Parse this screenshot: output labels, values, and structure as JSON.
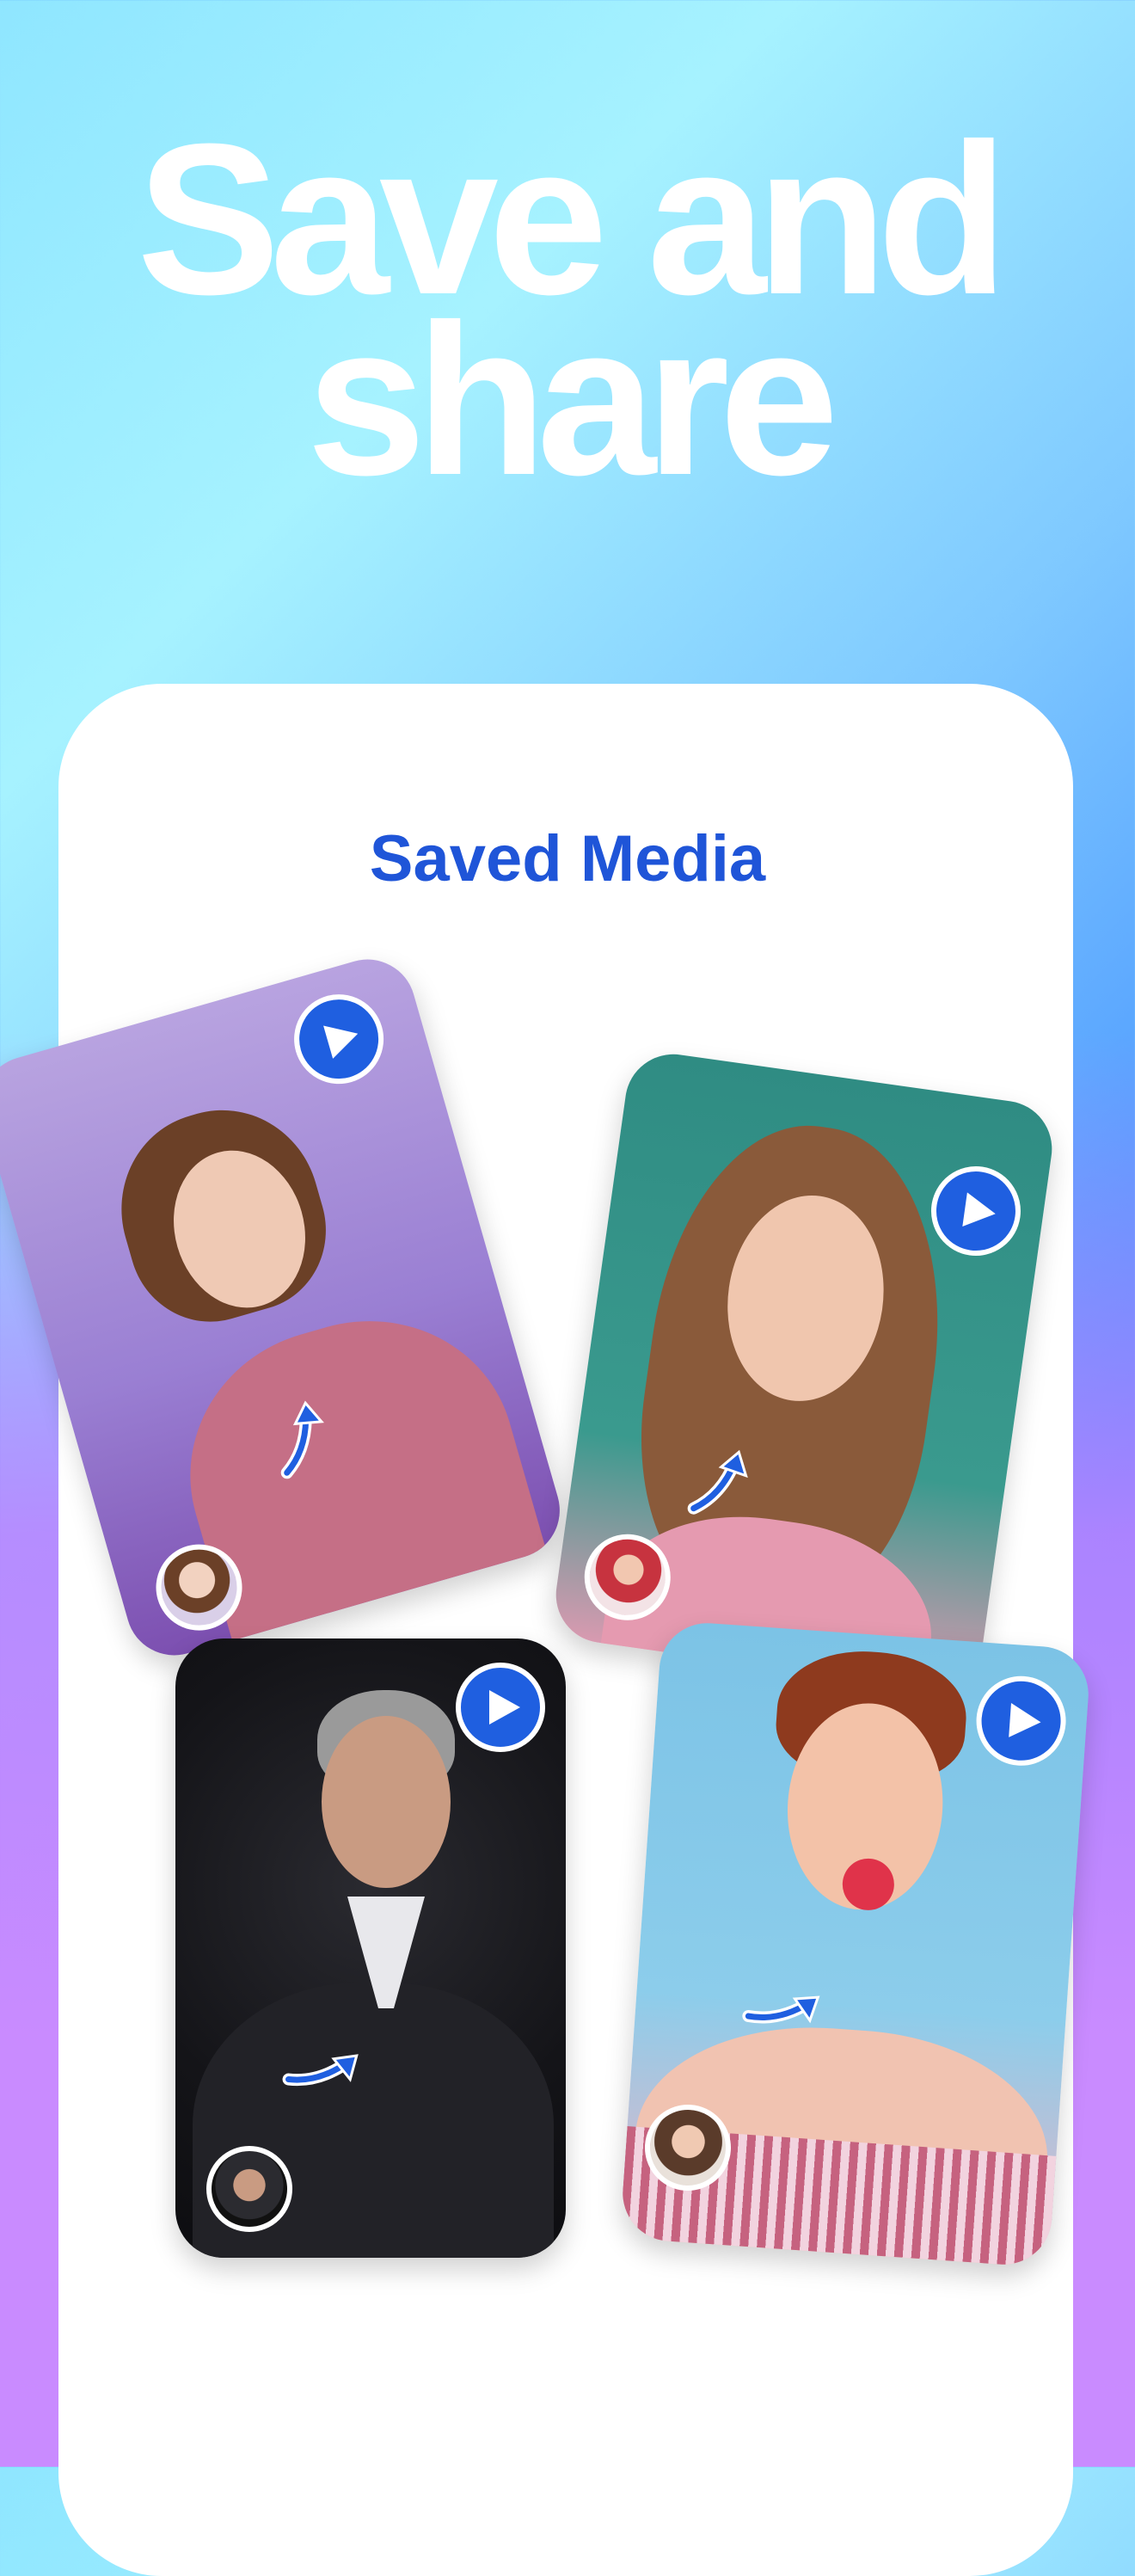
{
  "headline": {
    "line1": "Save and",
    "line2": "share"
  },
  "panel": {
    "title": "Saved Media"
  },
  "cards": [
    {
      "name": "card-purple",
      "bg": "#9b7ad6",
      "play": "play-icon"
    },
    {
      "name": "card-teal",
      "bg": "#2f8c83",
      "play": "play-icon"
    },
    {
      "name": "card-dark",
      "bg": "#141418",
      "play": "play-icon"
    },
    {
      "name": "card-blue",
      "bg": "#7cc3e6",
      "play": "play-icon"
    }
  ],
  "colors": {
    "accent": "#1f5fe0",
    "title": "#1f55d8",
    "white": "#ffffff"
  }
}
